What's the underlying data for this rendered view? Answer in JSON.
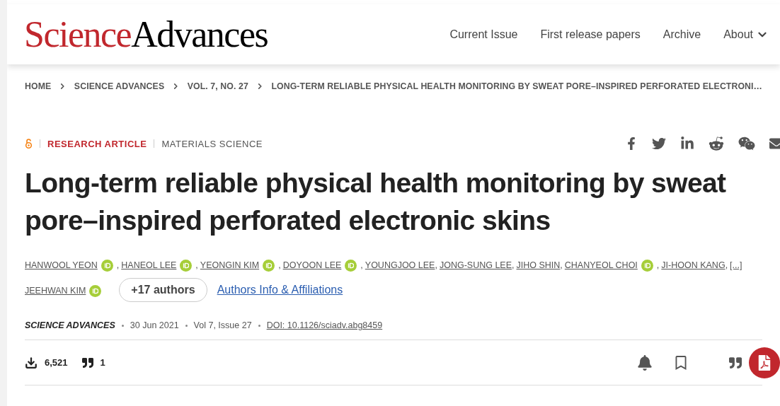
{
  "logo": {
    "first": "Science",
    "second": "Advances"
  },
  "nav": [
    {
      "label": "Current Issue",
      "dropdown": false
    },
    {
      "label": "First release papers",
      "dropdown": false
    },
    {
      "label": "Archive",
      "dropdown": false
    },
    {
      "label": "About",
      "dropdown": true
    }
  ],
  "breadcrumb": [
    "HOME",
    "SCIENCE ADVANCES",
    "VOL. 7, NO. 27",
    "LONG-TERM RELIABLE PHYSICAL HEALTH MONITORING BY SWEAT PORE–INSPIRED PERFORATED ELECTRONI…"
  ],
  "article_type": "RESEARCH ARTICLE",
  "subject": "MATERIALS SCIENCE",
  "open_access": true,
  "title": "Long-term reliable physical health monitoring by sweat pore–inspired perforated electronic skins",
  "authors": [
    {
      "name": "HANWOOL YEON",
      "orcid": true,
      "sep": ","
    },
    {
      "name": "HANEOL LEE",
      "orcid": true,
      "sep": ","
    },
    {
      "name": "YEONGIN KIM",
      "orcid": true,
      "sep": ","
    },
    {
      "name": "DOYOON LEE",
      "orcid": true,
      "sep": ","
    },
    {
      "name": "YOUNGJOO LEE",
      "orcid": false,
      "sep": ","
    },
    {
      "name": "JONG-SUNG LEE",
      "orcid": false,
      "sep": ","
    },
    {
      "name": "JIHO SHIN",
      "orcid": false,
      "sep": ","
    },
    {
      "name": "CHANYEOL CHOI",
      "orcid": true,
      "sep": ","
    },
    {
      "name": "JI-HOON KANG",
      "orcid": false,
      "sep": ","
    },
    {
      "name": "[...]",
      "orcid": false
    },
    {
      "name": "JEEHWAN KIM",
      "orcid": true
    }
  ],
  "more_authors": "+17 authors",
  "affiliations_link": "Authors Info & Affiliations",
  "meta": {
    "journal": "SCIENCE ADVANCES",
    "date": "30 Jun 2021",
    "issue": "Vol 7, Issue 27",
    "doi": "DOI: 10.1126/sciadv.abg8459"
  },
  "metrics": {
    "downloads": "6,521",
    "citations": "1"
  }
}
